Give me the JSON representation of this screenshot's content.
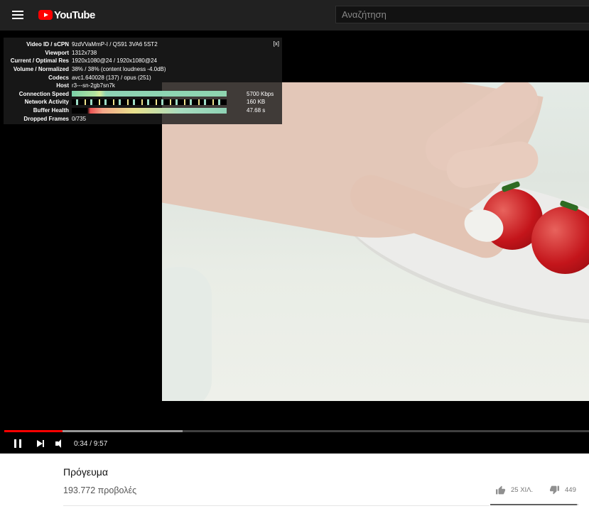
{
  "masthead": {
    "logo_text": "YouTube",
    "search_placeholder": "Αναζήτηση"
  },
  "stats": {
    "close_label": "[x]",
    "rows": [
      {
        "label": "Video ID / sCPN",
        "value": "9zdVVaMmP-I / QS91 3VA6 5ST2"
      },
      {
        "label": "Viewport",
        "value": "1312x738"
      },
      {
        "label": "Current / Optimal Res",
        "value": "1920x1080@24 / 1920x1080@24"
      },
      {
        "label": "Volume / Normalized",
        "value": "38% / 38% (content loudness -4.0dB)"
      },
      {
        "label": "Codecs",
        "value": "avc1.640028 (137) / opus (251)"
      },
      {
        "label": "Host",
        "value": "r3---sn-2gb7sn7k"
      }
    ],
    "connection_speed": {
      "label": "Connection Speed",
      "value": "5700 Kbps"
    },
    "network_activity": {
      "label": "Network Activity",
      "value": "160 KB"
    },
    "buffer_health": {
      "label": "Buffer Health",
      "value": "47.68 s"
    },
    "dropped_frames": {
      "label": "Dropped Frames",
      "value": "0/735"
    }
  },
  "player": {
    "current_time": "0:34",
    "duration": "9:57",
    "timecode": "0:34 / 9:57",
    "played_fraction": 0.1,
    "loaded_fraction": 0.305
  },
  "video": {
    "title": "Πρόγευμα",
    "views": "193.772 προβολές",
    "likes": "25 ΧΙΛ.",
    "dislikes": "449",
    "like_fraction": 0.98
  },
  "colors": {
    "masthead_bg": "#212121",
    "brand_red": "#ff0000",
    "progress_red": "#ff0000"
  },
  "icons": {
    "menu": "menu-icon",
    "logo": "youtube-logo-icon",
    "pause": "pause-icon",
    "next": "next-icon",
    "volume": "volume-icon",
    "like": "thumb-up-icon",
    "dislike": "thumb-down-icon"
  }
}
